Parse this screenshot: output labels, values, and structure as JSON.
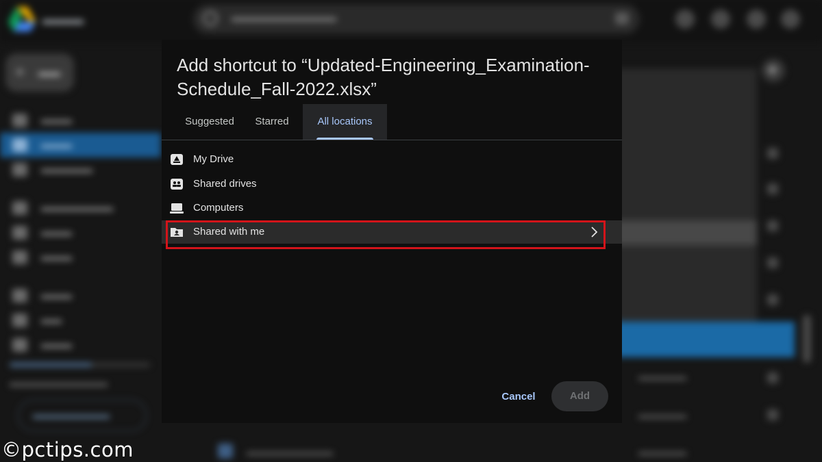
{
  "dialog": {
    "title": "Add shortcut to “Updated-Engineering_Examination-Schedule_Fall-2022.xlsx”",
    "tabs": [
      {
        "label": "Suggested",
        "active": false
      },
      {
        "label": "Starred",
        "active": false
      },
      {
        "label": "All locations",
        "active": true
      }
    ],
    "locations": [
      {
        "label": "My Drive",
        "icon": "my-drive-icon"
      },
      {
        "label": "Shared drives",
        "icon": "shared-drives-icon"
      },
      {
        "label": "Computers",
        "icon": "computer-icon"
      },
      {
        "label": "Shared with me",
        "icon": "shared-with-me-icon",
        "highlighted": true,
        "has_chevron": true
      }
    ],
    "buttons": {
      "cancel": "Cancel",
      "add": "Add"
    }
  },
  "colors": {
    "dialog_bg": "#0f0f0f",
    "accent": "#a8c7fa",
    "highlight_border": "#d3141a",
    "selection_blue": "#1a5b92"
  },
  "watermark": "©pctips.com"
}
